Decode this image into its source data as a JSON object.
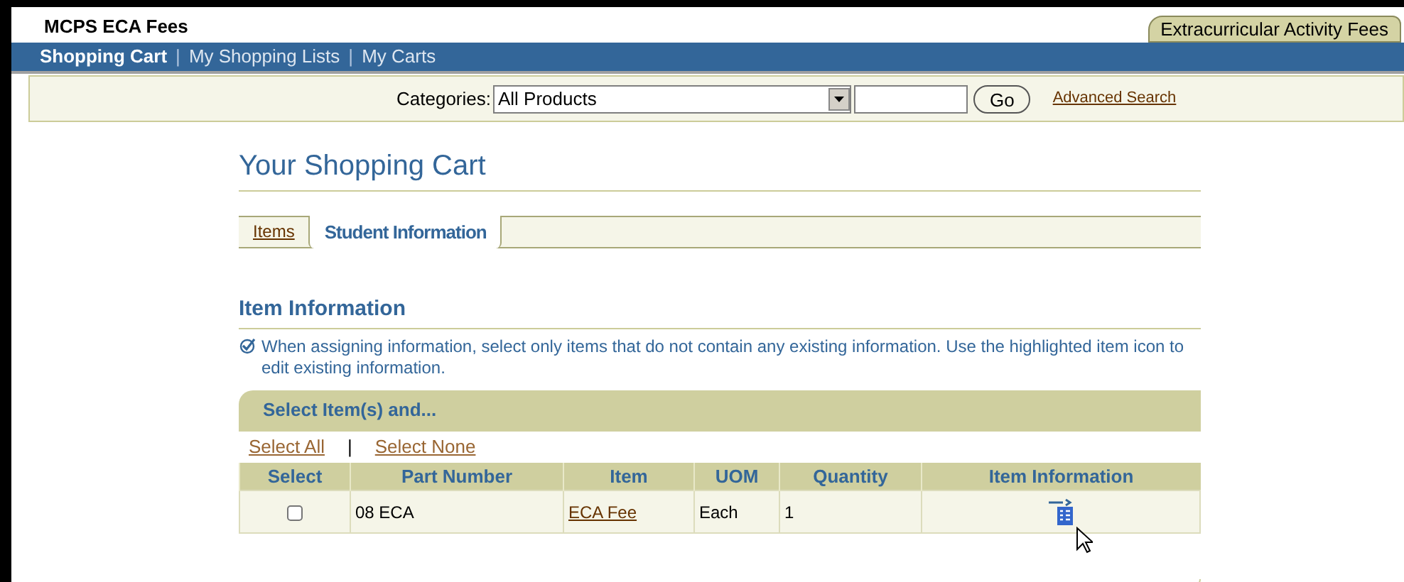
{
  "header": {
    "title": "MCPS ECA Fees",
    "global_tab": "Extracurricular Activity Fees"
  },
  "nav_separators": [
    "|",
    "|"
  ],
  "nav": [
    {
      "label": "Shopping Cart",
      "selected": true
    },
    {
      "label": "My Shopping Lists",
      "selected": false
    },
    {
      "label": "My Carts",
      "selected": false
    }
  ],
  "search": {
    "categories_label": "Categories:",
    "category_value": "All Products",
    "go_button": "Go",
    "advanced_link": "Advanced Search"
  },
  "page_title": "Your Shopping Cart",
  "tabs": [
    {
      "label": "Items",
      "selected": false
    },
    {
      "label": "Student Information",
      "selected": true
    }
  ],
  "section": {
    "title": "Item Information",
    "tip": "When assigning information, select only items that do not contain any existing information. Use the highlighted item icon to edit existing information."
  },
  "select_bar": {
    "title": "Select Item(s) and...",
    "select_all": "Select All",
    "separator": "|",
    "select_none": "Select None"
  },
  "table": {
    "columns": [
      "Select",
      "Part Number",
      "Item",
      "UOM",
      "Quantity",
      "Item Information"
    ],
    "rows": [
      {
        "checked": false,
        "part_number": "08 ECA",
        "item": "ECA Fee",
        "uom": "Each",
        "quantity": "1"
      }
    ]
  }
}
